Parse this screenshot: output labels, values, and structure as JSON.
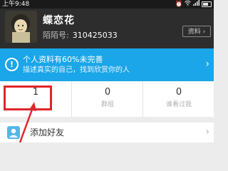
{
  "status_bar": {
    "time": "上午9:48",
    "icons": [
      "signal-icon",
      "wifi-icon",
      "battery-icon"
    ]
  },
  "profile": {
    "name": "蝶恋花",
    "id_label": "陌陌号:",
    "id_value": "310425033",
    "profile_button": "资料"
  },
  "notice": {
    "title": "个人资料有60%未完善",
    "subtitle": "描述真实的自己，找到欣赏你的人",
    "icon": "exclamation-icon"
  },
  "stats": [
    {
      "value": "1",
      "label": ""
    },
    {
      "value": "0",
      "label": "群组"
    },
    {
      "value": "0",
      "label": "谁看过我"
    }
  ],
  "add_friend": {
    "label": "添加好友",
    "icon": "add-person-icon"
  },
  "colors": {
    "header_bg": "#2d2d2d",
    "notice_bg": "#1aa6e8",
    "highlight": "#e0262b"
  }
}
